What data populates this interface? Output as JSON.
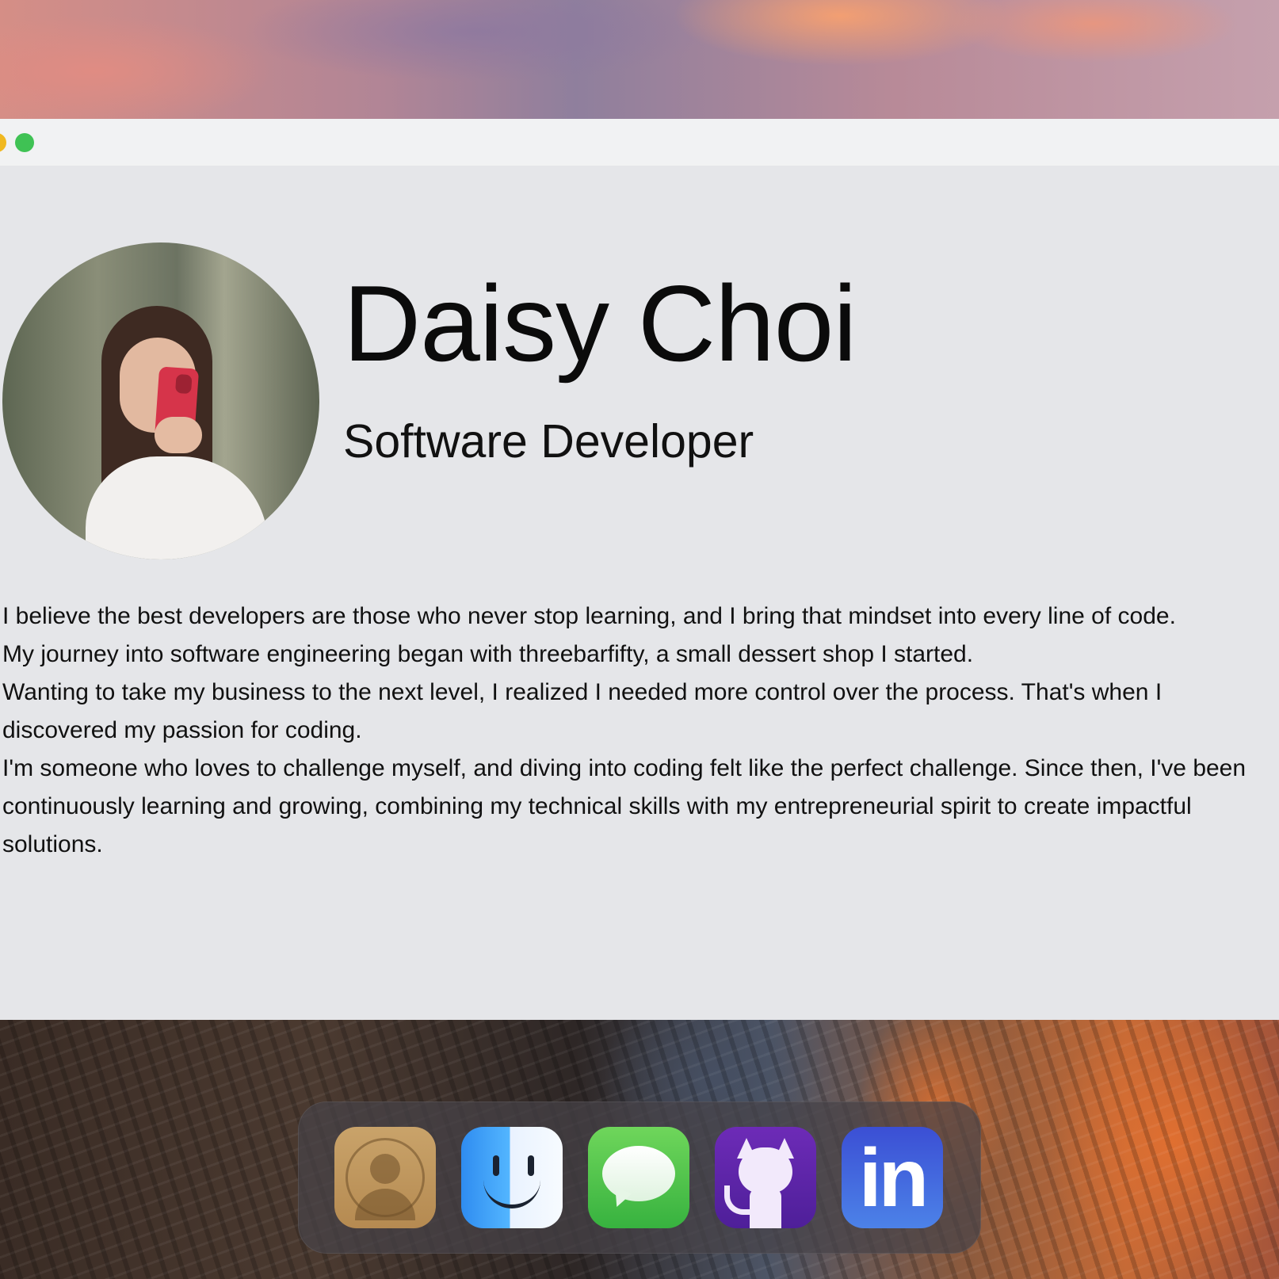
{
  "window": {
    "traffic_lights": [
      "yellow",
      "green"
    ]
  },
  "profile": {
    "name": "Daisy Choi",
    "title": "Software Developer",
    "bio": [
      "I believe the best developers are those who never stop learning, and I bring that mindset into every line of code.",
      "My journey into software engineering began with threebarfifty, a small dessert shop I started.",
      "Wanting to take my business to the next level, I realized I needed more control over the process. That's when I discovered my passion for coding.",
      "I'm someone who loves to challenge myself, and diving into coding felt like the perfect challenge. Since then, I've been continuously learning and growing, combining my technical skills with my entrepreneurial spirit to create impactful solutions."
    ]
  },
  "dock": {
    "apps": [
      {
        "icon": "contacts-icon"
      },
      {
        "icon": "finder-icon"
      },
      {
        "icon": "messages-icon"
      },
      {
        "icon": "github-icon"
      },
      {
        "icon": "linkedin-icon",
        "glyph": "in"
      }
    ]
  },
  "colors": {
    "window_bg": "#e5e6e9",
    "titlebar_bg": "#f1f2f3",
    "traffic_yellow": "#f0b820",
    "traffic_green": "#3fc254",
    "github_purple": "#5b23a8",
    "linkedin_blue": "#3f63dc"
  }
}
